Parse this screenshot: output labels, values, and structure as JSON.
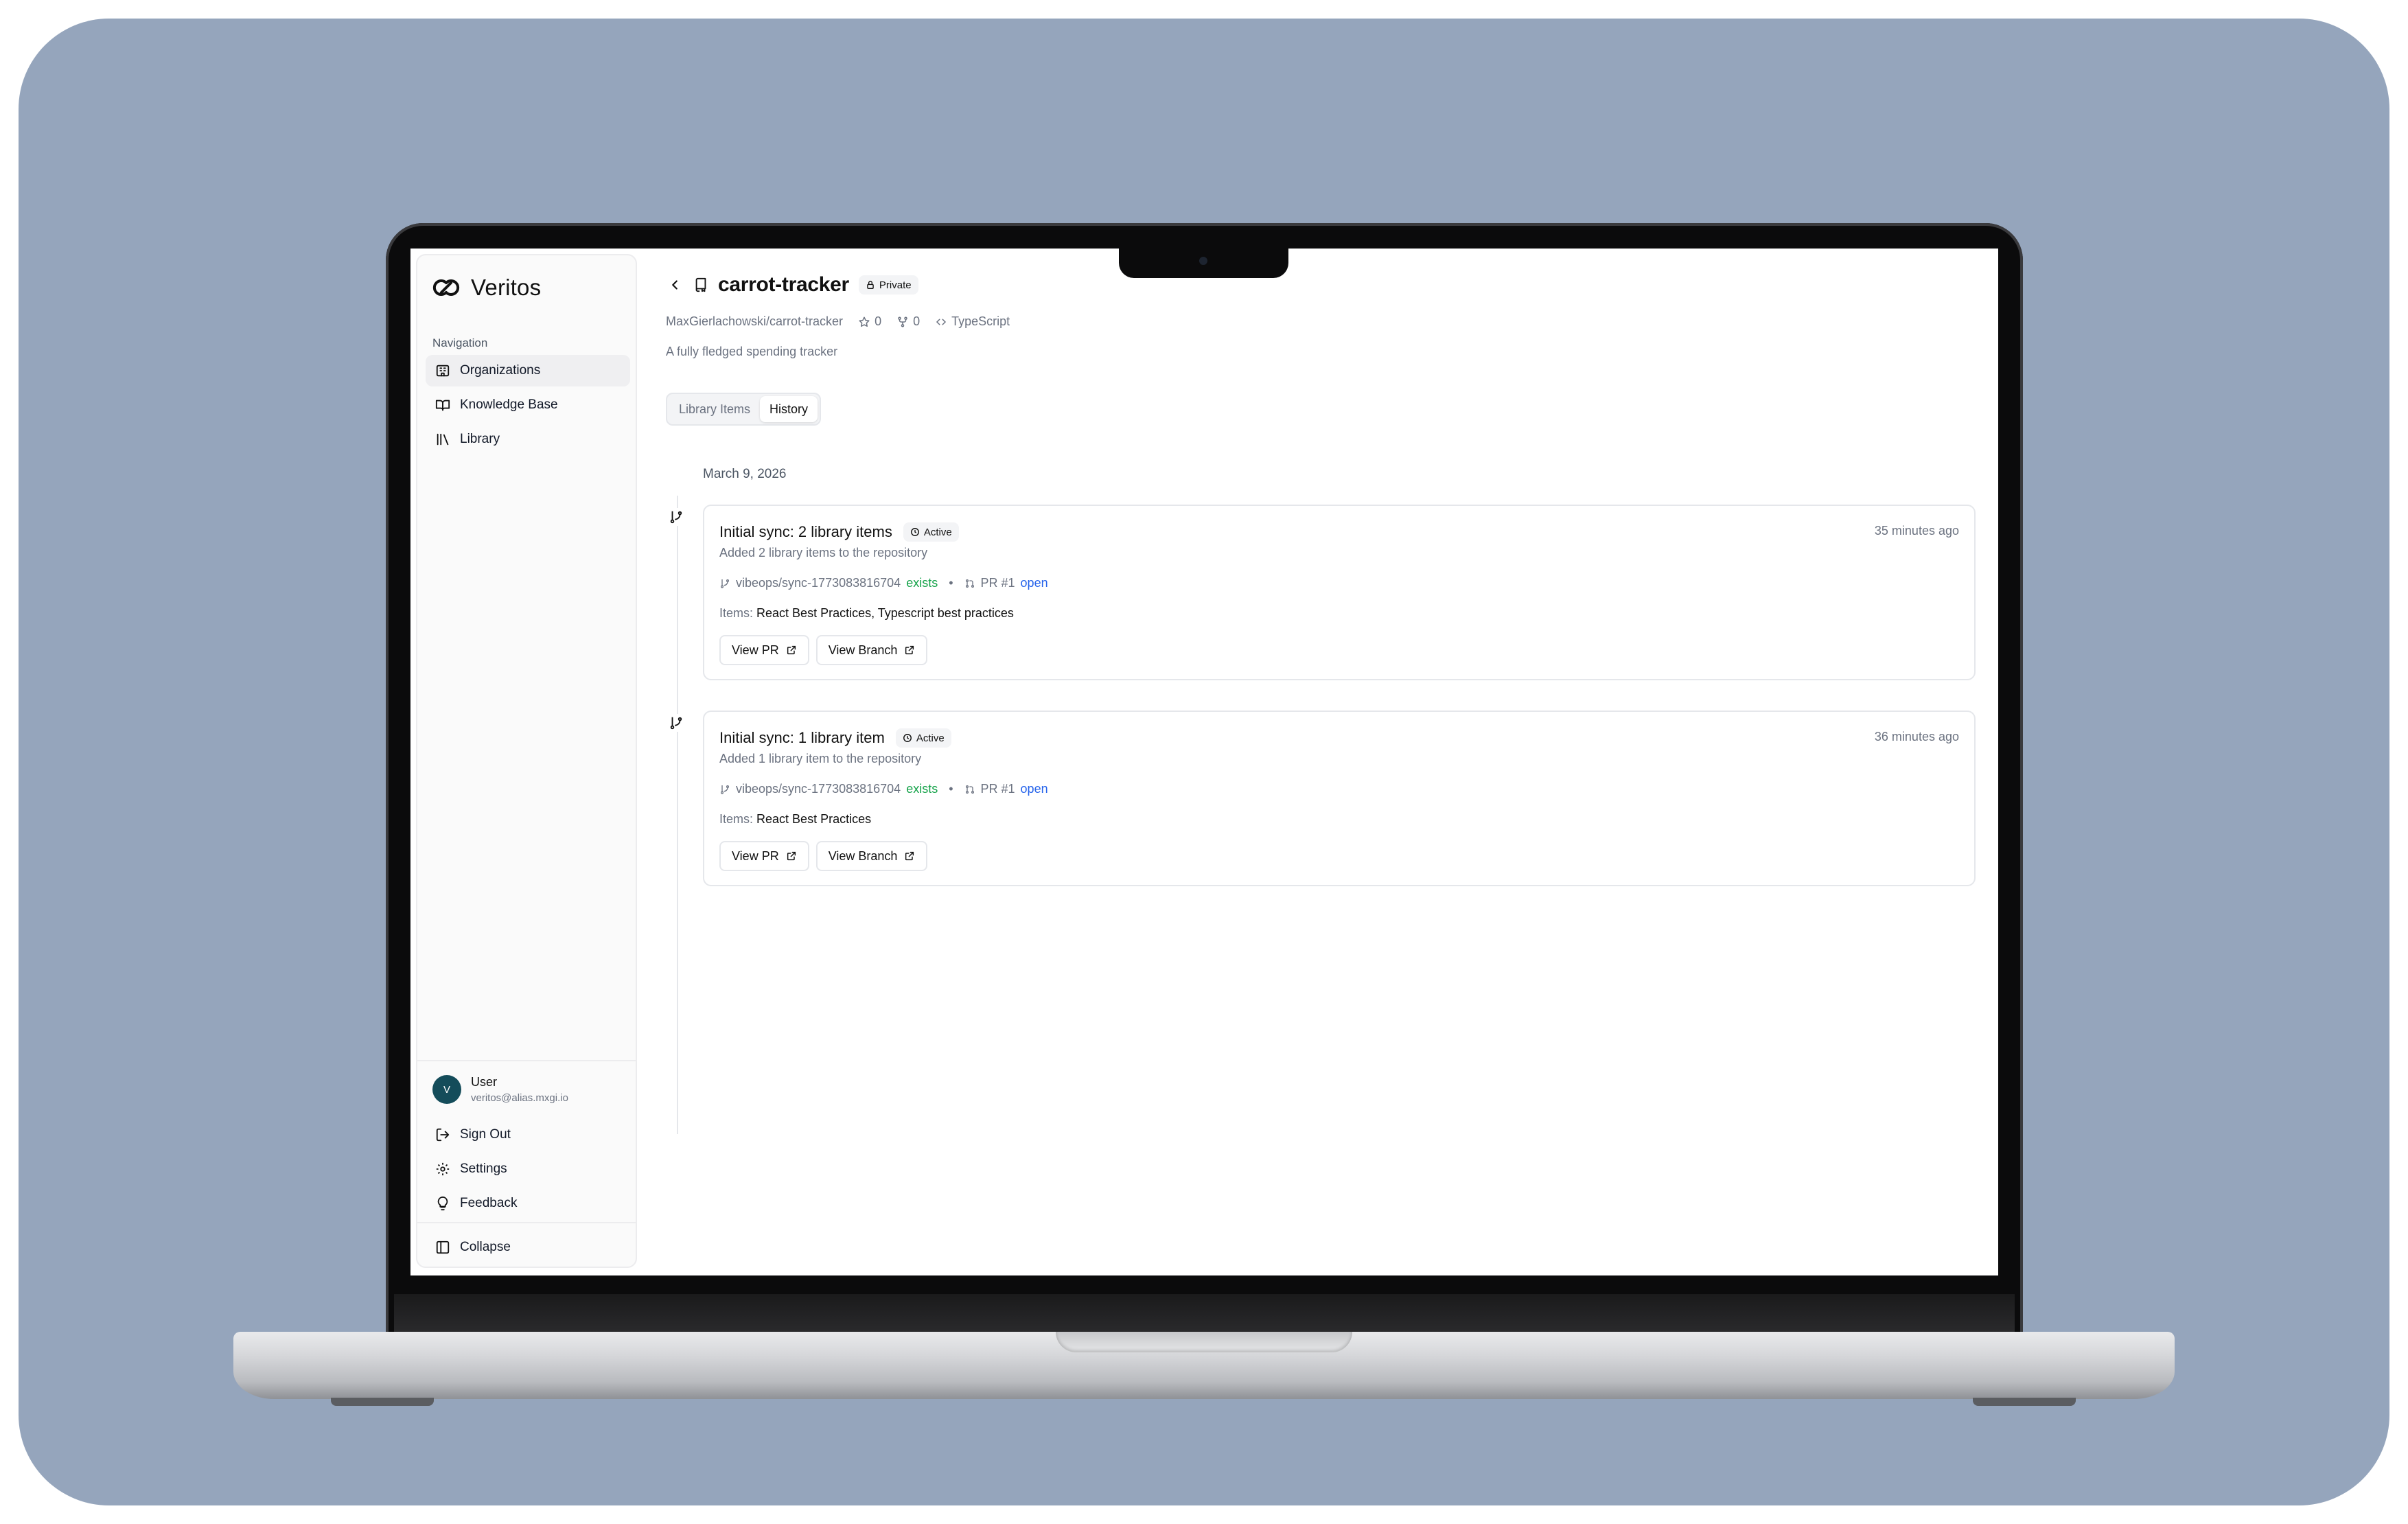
{
  "app": {
    "brand": "Veritos"
  },
  "sidebar": {
    "heading": "Navigation",
    "items": [
      {
        "label": "Organizations",
        "icon": "building-icon",
        "active": true
      },
      {
        "label": "Knowledge Base",
        "icon": "book-icon",
        "active": false
      },
      {
        "label": "Library",
        "icon": "library-icon",
        "active": false
      }
    ],
    "user": {
      "initial": "V",
      "name": "User",
      "email": "veritos@alias.mxgi.io"
    },
    "footer_items": [
      {
        "label": "Sign Out",
        "icon": "sign-out-icon"
      },
      {
        "label": "Settings",
        "icon": "gear-icon"
      },
      {
        "label": "Feedback",
        "icon": "lightbulb-icon"
      }
    ],
    "collapse_label": "Collapse"
  },
  "repo": {
    "name": "carrot-tracker",
    "visibility": "Private",
    "full_name": "MaxGierlachowski/carrot-tracker",
    "stars": "0",
    "forks": "0",
    "language": "TypeScript",
    "description": "A fully fledged spending tracker"
  },
  "tabs": [
    {
      "label": "Library Items",
      "active": false
    },
    {
      "label": "History",
      "active": true
    }
  ],
  "history": {
    "date": "March 9, 2026",
    "entries": [
      {
        "title": "Initial sync: 2 library items",
        "status": "Active",
        "subtitle": "Added 2 library items to the repository",
        "time": "35 minutes ago",
        "branch": "vibeops/sync-1773083816704",
        "branch_state": "exists",
        "pr": "PR #1",
        "pr_state": "open",
        "items_label": "Items:",
        "items": "React Best Practices, Typescript best practices",
        "view_pr": "View PR",
        "view_branch": "View Branch"
      },
      {
        "title": "Initial sync: 1 library item",
        "status": "Active",
        "subtitle": "Added 1 library item to the repository",
        "time": "36 minutes ago",
        "branch": "vibeops/sync-1773083816704",
        "branch_state": "exists",
        "pr": "PR #1",
        "pr_state": "open",
        "items_label": "Items:",
        "items": "React Best Practices",
        "view_pr": "View PR",
        "view_branch": "View Branch"
      }
    ]
  },
  "colors": {
    "backdrop": "#95a5bc",
    "avatar": "#144c5a",
    "exists": "#16a34a",
    "open": "#2563eb"
  }
}
